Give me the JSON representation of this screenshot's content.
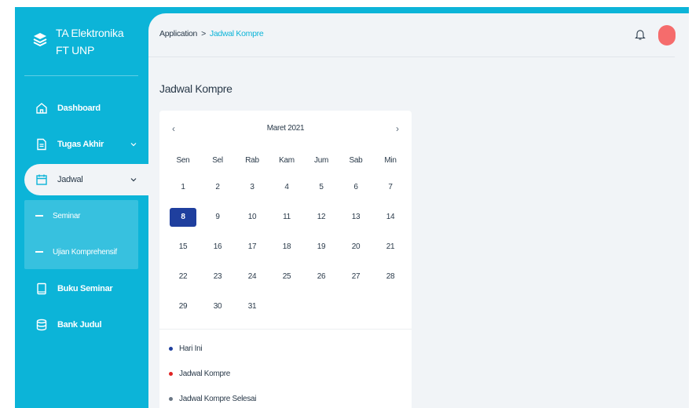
{
  "brand": {
    "line1": "TA Elektronika",
    "line2": "FT UNP"
  },
  "sidebar": {
    "items": [
      {
        "label": "Dashboard",
        "icon": "home-icon"
      },
      {
        "label": "Tugas Akhir",
        "icon": "file-text-icon"
      },
      {
        "label": "Jadwal",
        "icon": "calendar-icon"
      },
      {
        "label": "Buku Seminar",
        "icon": "book-icon"
      },
      {
        "label": "Bank Judul",
        "icon": "database-icon"
      }
    ],
    "sub_items": [
      {
        "label": "Seminar"
      },
      {
        "label": "Ujian Komprehensif"
      }
    ]
  },
  "breadcrumb": {
    "root": "Application",
    "separator": ">",
    "current": "Jadwal Kompre"
  },
  "page_title": "Jadwal Kompre",
  "calendar": {
    "prev": "‹",
    "next": "›",
    "month": "Maret 2021",
    "days_of_week": [
      "Sen",
      "Sel",
      "Rab",
      "Kam",
      "Jum",
      "Sab",
      "Min"
    ],
    "weeks": [
      [
        "1",
        "2",
        "3",
        "4",
        "5",
        "6",
        "7"
      ],
      [
        "8",
        "9",
        "10",
        "11",
        "12",
        "13",
        "14"
      ],
      [
        "15",
        "16",
        "17",
        "18",
        "19",
        "20",
        "21"
      ],
      [
        "22",
        "23",
        "24",
        "25",
        "26",
        "27",
        "28"
      ],
      [
        "29",
        "30",
        "31",
        "",
        "",
        "",
        ""
      ]
    ],
    "today": "8"
  },
  "legend": [
    {
      "label": "Hari Ini",
      "color": "#1f3f9e"
    },
    {
      "label": "Jadwal Kompre",
      "color": "#e02424"
    },
    {
      "label": "Jadwal Kompre Selesai",
      "color": "#6b7785"
    }
  ],
  "colors": {
    "accent": "#0cb4d8",
    "today": "#1f3f9e",
    "avatar": "#f56c6c"
  }
}
